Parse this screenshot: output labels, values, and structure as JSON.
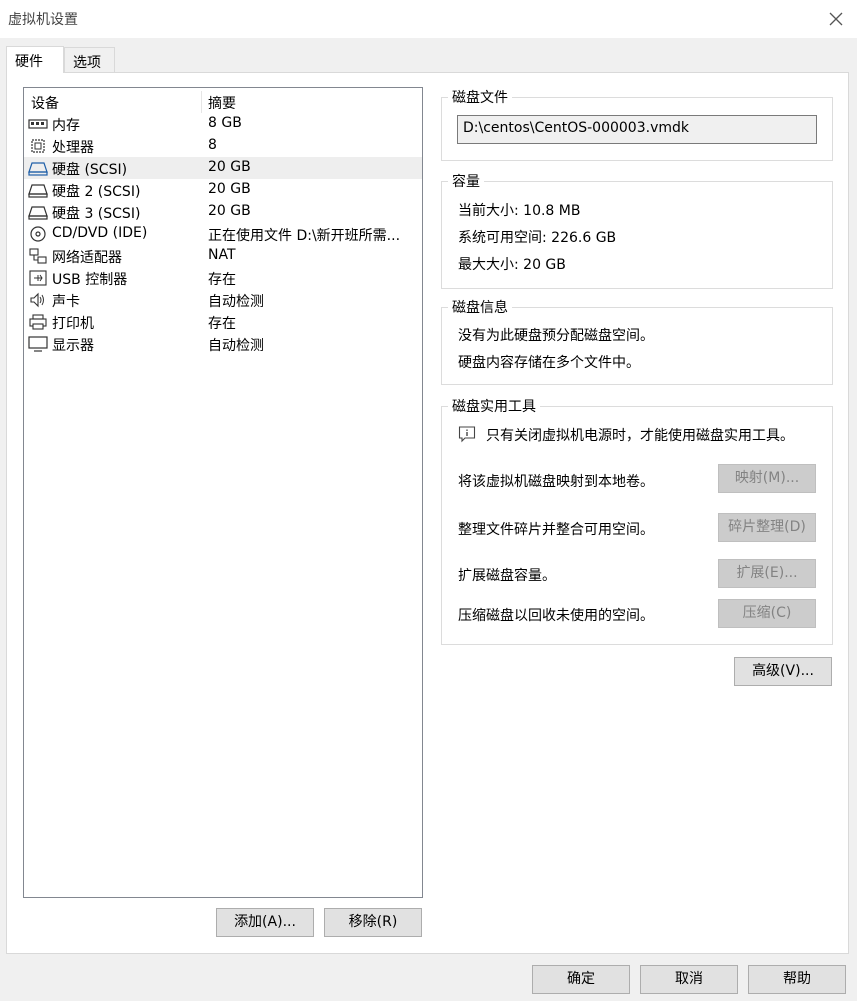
{
  "window": {
    "title": "虚拟机设置"
  },
  "tabs": [
    {
      "label": "硬件",
      "active": true
    },
    {
      "label": "选项",
      "active": false
    }
  ],
  "device_list": {
    "headers": [
      "设备",
      "摘要"
    ],
    "rows": [
      {
        "name": "内存",
        "summary": "8 GB",
        "icon": "memory-icon"
      },
      {
        "name": "处理器",
        "summary": "8",
        "icon": "processor-icon"
      },
      {
        "name": "硬盘 (SCSI)",
        "summary": "20 GB",
        "icon": "hard-disk-icon",
        "selected": true
      },
      {
        "name": "硬盘 2 (SCSI)",
        "summary": "20 GB",
        "icon": "hard-disk-icon"
      },
      {
        "name": "硬盘 3 (SCSI)",
        "summary": "20 GB",
        "icon": "hard-disk-icon"
      },
      {
        "name": "CD/DVD (IDE)",
        "summary": "正在使用文件 D:\\新开班所需...",
        "icon": "cd-dvd-icon"
      },
      {
        "name": "网络适配器",
        "summary": "NAT",
        "icon": "network-adapter-icon"
      },
      {
        "name": "USB 控制器",
        "summary": "存在",
        "icon": "usb-icon"
      },
      {
        "name": "声卡",
        "summary": "自动检测",
        "icon": "speaker-icon"
      },
      {
        "name": "打印机",
        "summary": "存在",
        "icon": "printer-icon"
      },
      {
        "name": "显示器",
        "summary": "自动检测",
        "icon": "monitor-icon"
      }
    ],
    "add_label": "添加(A)...",
    "remove_label": "移除(R)"
  },
  "disk_file": {
    "title": "磁盘文件",
    "path": "D:\\centos\\CentOS-000003.vmdk"
  },
  "capacity": {
    "title": "容量",
    "current_size": "当前大小: 10.8 MB",
    "available": "系统可用空间: 226.6 GB",
    "max_size": "最大大小: 20 GB"
  },
  "disk_info": {
    "title": "磁盘信息",
    "line1": "没有为此硬盘预分配磁盘空间。",
    "line2": "硬盘内容存储在多个文件中。"
  },
  "disk_utilities": {
    "title": "磁盘实用工具",
    "notice": "只有关闭虚拟机电源时，才能使用磁盘实用工具。",
    "map_text": "将该虚拟机磁盘映射到本地卷。",
    "map_button": "映射(M)...",
    "defrag_text": "整理文件碎片并整合可用空间。",
    "defrag_button": "碎片整理(D)",
    "expand_text": "扩展磁盘容量。",
    "expand_button": "扩展(E)...",
    "compact_text": "压缩磁盘以回收未使用的空间。",
    "compact_button": "压缩(C)"
  },
  "advanced_button": "高级(V)...",
  "footer": {
    "ok": "确定",
    "cancel": "取消",
    "help": "帮助"
  }
}
